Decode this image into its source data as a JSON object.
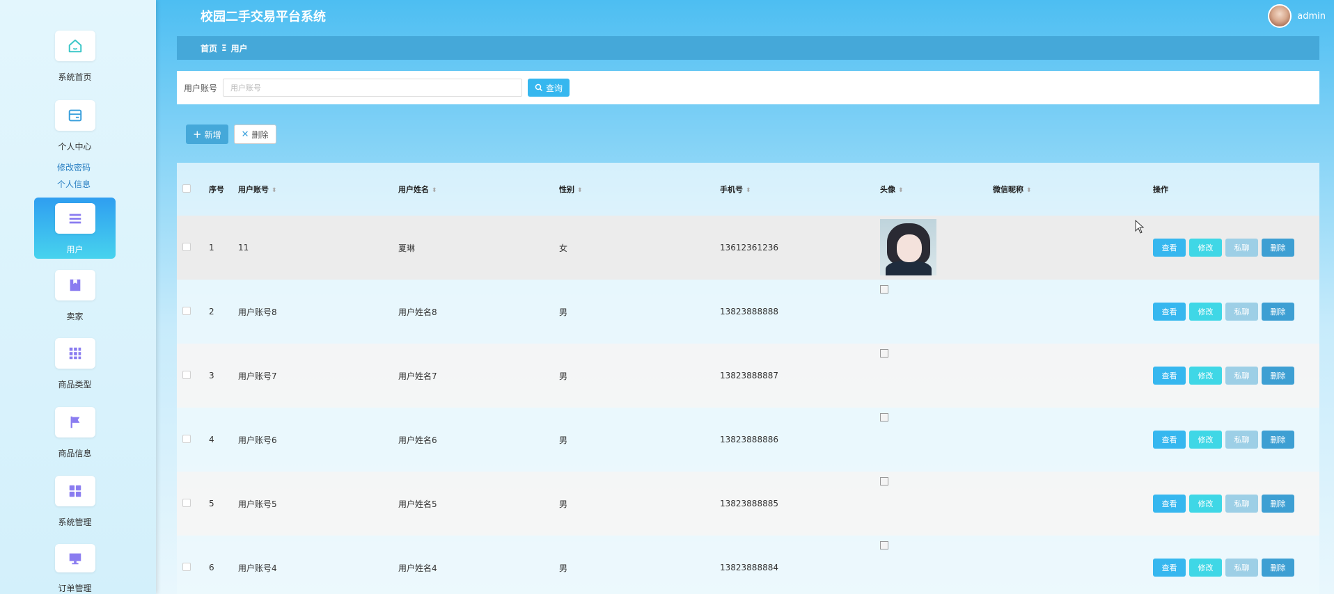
{
  "header": {
    "title": "校园二手交易平台系统",
    "username": "admin"
  },
  "sidebar": {
    "items": [
      {
        "label": "系统首页",
        "icon": "home-icon"
      },
      {
        "label": "个人中心",
        "icon": "wallet-icon"
      },
      {
        "label": "用户",
        "icon": "list-icon"
      },
      {
        "label": "卖家",
        "icon": "bookmark-icon"
      },
      {
        "label": "商品类型",
        "icon": "grid-icon"
      },
      {
        "label": "商品信息",
        "icon": "flag-icon"
      },
      {
        "label": "系统管理",
        "icon": "apps-icon"
      },
      {
        "label": "订单管理",
        "icon": "monitor-icon"
      }
    ],
    "subitems": [
      "修改密码",
      "个人信息"
    ],
    "active": "用户"
  },
  "breadcrumb": {
    "home": "首页",
    "separator": "Ξ",
    "current": "用户"
  },
  "search": {
    "label": "用户账号",
    "placeholder": "用户账号",
    "value": "",
    "button": "查询"
  },
  "actions": {
    "add": "新增",
    "delete": "删除"
  },
  "table": {
    "columns": [
      "序号",
      "用户账号",
      "用户姓名",
      "性别",
      "手机号",
      "头像",
      "微信昵称",
      "操作"
    ],
    "rows": [
      {
        "idx": "1",
        "account": "11",
        "name": "夏琳",
        "sex": "女",
        "phone": "13612361236",
        "avatar": "photo",
        "wechat": ""
      },
      {
        "idx": "2",
        "account": "用户账号8",
        "name": "用户姓名8",
        "sex": "男",
        "phone": "13823888888",
        "avatar": "broken",
        "wechat": ""
      },
      {
        "idx": "3",
        "account": "用户账号7",
        "name": "用户姓名7",
        "sex": "男",
        "phone": "13823888887",
        "avatar": "broken",
        "wechat": ""
      },
      {
        "idx": "4",
        "account": "用户账号6",
        "name": "用户姓名6",
        "sex": "男",
        "phone": "13823888886",
        "avatar": "broken",
        "wechat": ""
      },
      {
        "idx": "5",
        "account": "用户账号5",
        "name": "用户姓名5",
        "sex": "男",
        "phone": "13823888885",
        "avatar": "broken",
        "wechat": ""
      },
      {
        "idx": "6",
        "account": "用户账号4",
        "name": "用户姓名4",
        "sex": "男",
        "phone": "13823888884",
        "avatar": "broken",
        "wechat": ""
      }
    ],
    "row_actions": {
      "view": "查看",
      "edit": "修改",
      "chat": "私聊",
      "delete": "删除"
    }
  },
  "colors": {
    "accent": "#36b7ef",
    "breadcrumb_bg": "#45a8d9",
    "edit_button": "#3fd7e6",
    "chat_button": "#9dcfe6",
    "delete_button": "#3d9fd3",
    "icon_purple": "#8a7cf0"
  }
}
